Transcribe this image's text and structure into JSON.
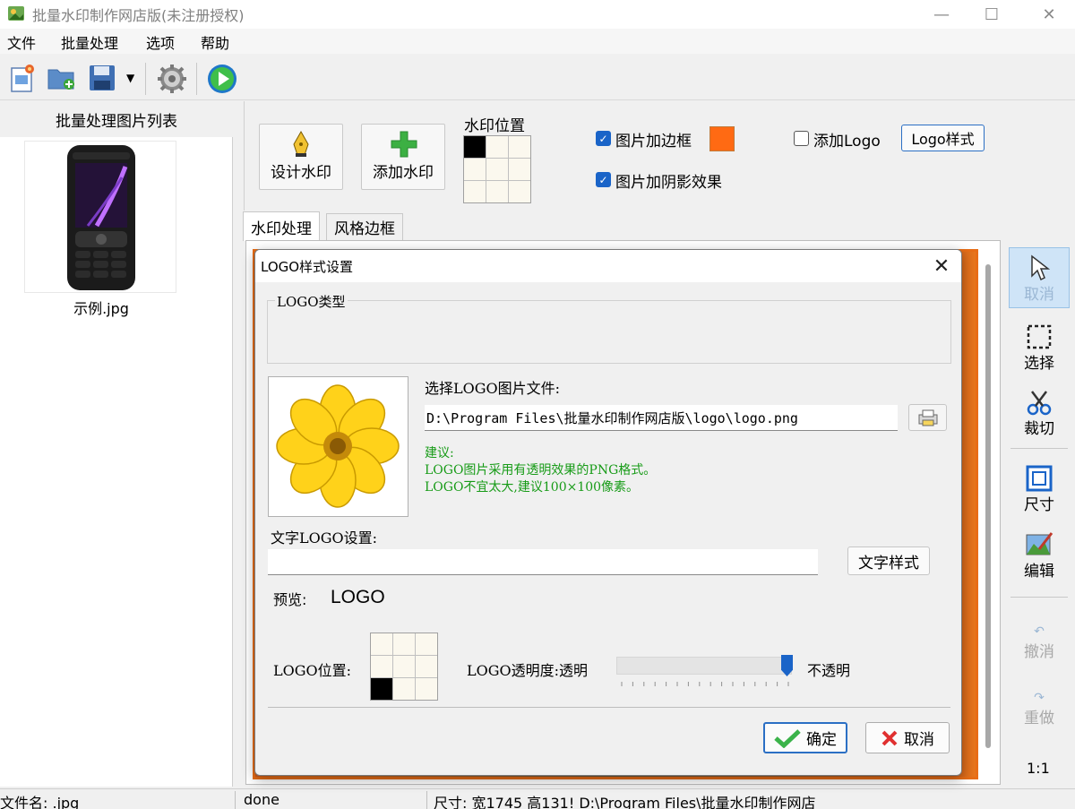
{
  "window": {
    "title": "批量水印制作网店版(未注册授权)",
    "minimize": "—",
    "maximize": "☐",
    "close": "✕"
  },
  "menu": [
    "文件",
    "批量处理",
    "选项",
    "帮助"
  ],
  "left_panel": {
    "header": "批量处理图片列表",
    "images": [
      {
        "name": "示例.jpg"
      }
    ]
  },
  "settings": {
    "design_watermark": "设计水印",
    "add_watermark": "添加水印",
    "watermark_position_label": "水印位置",
    "watermark_position_selected": "top-left",
    "picture_border": {
      "label": "图片加边框",
      "checked": true,
      "color": "#ff6a13"
    },
    "picture_shadow": {
      "label": "图片加阴影效果",
      "checked": true
    },
    "add_logo": {
      "label": "添加Logo",
      "checked": false
    },
    "logo_style_button": "Logo样式"
  },
  "tabs": [
    {
      "label": "水印处理",
      "active": true
    },
    {
      "label": "风格边框",
      "active": false
    }
  ],
  "tools": [
    {
      "label": "取消",
      "icon": "pointer-icon",
      "state": "active"
    },
    {
      "label": "选择",
      "icon": "select-rect-icon",
      "state": "normal"
    },
    {
      "label": "裁切",
      "icon": "scissors-icon",
      "state": "normal"
    },
    {
      "label": "尺寸",
      "icon": "resize-icon",
      "state": "normal"
    },
    {
      "label": "编辑",
      "icon": "edit-paint-icon",
      "state": "normal"
    },
    {
      "label": "撤消",
      "icon": "undo-icon",
      "state": "disabled"
    },
    {
      "label": "重做",
      "icon": "redo-icon",
      "state": "disabled"
    }
  ],
  "zoom": "1:1",
  "status": {
    "filename": "文件名: .jpg",
    "state": "done",
    "info": "尺寸: 宽1745 高131! D:\\Program Files\\批量水印制作网店"
  },
  "dialog": {
    "title": "LOGO样式设置",
    "logo_type_label": "LOGO类型",
    "select_file_label": "选择LOGO图片文件:",
    "file_path": "D:\\Program Files\\批量水印制作网店版\\logo\\logo.png",
    "hint_title": "建议:",
    "hint_line1": "LOGO图片采用有透明效果的PNG格式。",
    "hint_line2": "LOGO不宜太大,建议100×100像素。",
    "text_logo_label": "文字LOGO设置:",
    "text_logo_value": "",
    "text_style_button": "文字样式",
    "preview_label": "预览:",
    "preview_text": "LOGO",
    "logo_position_label": "LOGO位置:",
    "logo_position_selected": "bottom-left",
    "opacity_label": "LOGO透明度:透明",
    "opacity_max_label": "不透明",
    "opacity_value": 1.0,
    "ok_button": "确定",
    "cancel_button": "取消"
  },
  "colors": {
    "accent": "#1a64c8",
    "hint": "#179b17",
    "border_color": "#ff6a13"
  }
}
